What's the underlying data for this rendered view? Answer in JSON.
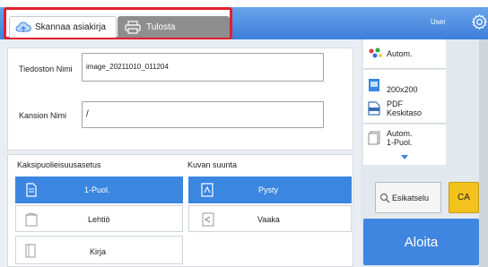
{
  "header": {
    "tabs": [
      {
        "label": "Skannaa asiakirja",
        "icon": "cloud-scan-icon",
        "selected": true
      },
      {
        "label": "Tulosta",
        "icon": "printer-icon",
        "selected": false
      }
    ],
    "user_label": "User",
    "settings_icon": "gear-icon"
  },
  "form": {
    "file_name_label": "Tiedoston Nimi",
    "file_name_value": "image_20211010_011204",
    "folder_name_label": "Kansion Nimi",
    "folder_name_value": "/"
  },
  "duplex": {
    "title": "Kaksipuolieisuusasetus",
    "options": [
      {
        "label": "1-Puol.",
        "icon": "single-sided-icon",
        "selected": true
      },
      {
        "label": "Lehtiö",
        "icon": "tablet-icon",
        "selected": false
      },
      {
        "label": "Kirja",
        "icon": "book-icon",
        "selected": false
      }
    ]
  },
  "orientation": {
    "title": "Kuvan suunta",
    "options": [
      {
        "label": "Pysty",
        "icon": "portrait-icon",
        "selected": true
      },
      {
        "label": "Vaaka",
        "icon": "landscape-icon",
        "selected": false
      }
    ]
  },
  "settings": [
    {
      "icon": "color-mode-icon",
      "line1": "Autom.",
      "line2": ""
    },
    {
      "icon": "resolution-icon",
      "line1": "200x200",
      "line2": ""
    },
    {
      "icon": "pdf-format-icon",
      "line1": "PDF",
      "line2": "Keskitaso"
    },
    {
      "icon": "original-size-icon",
      "line1": "Autom.",
      "line2": "1-Puol."
    }
  ],
  "actions": {
    "preview_label": "Esikatselu",
    "ca_label": "CA",
    "start_label": "Aloita"
  },
  "colors": {
    "accent": "#3a86e0",
    "highlight_border": "#e0202c",
    "ca_button": "#f4c21e"
  }
}
